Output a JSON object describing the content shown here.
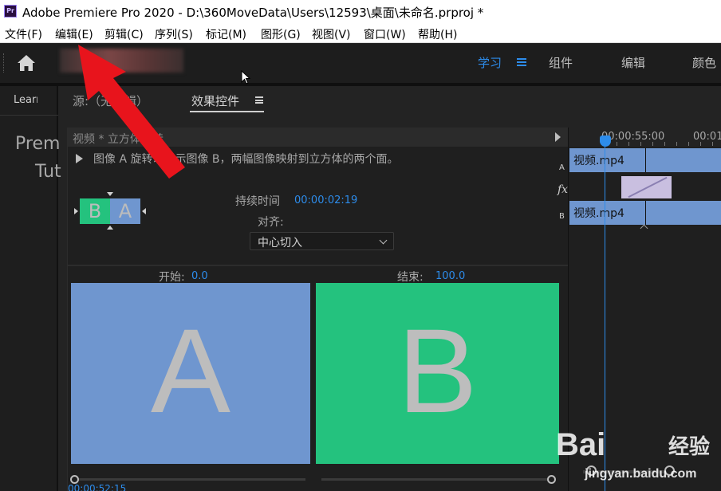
{
  "window": {
    "app_icon_label": "Pr",
    "title": "Adobe Premiere Pro 2020 - D:\\360MoveData\\Users\\12593\\桌面\\未命名.prproj *"
  },
  "menu": [
    "文件(F)",
    "编辑(E)",
    "剪辑(C)",
    "序列(S)",
    "标记(M)",
    "图形(G)",
    "视图(V)",
    "窗口(W)",
    "帮助(H)"
  ],
  "workspace_tabs": [
    "学习",
    "组件",
    "编辑",
    "颜色"
  ],
  "learn_panel": {
    "tab": "Learn",
    "line1": "Prem",
    "line2": "Tut"
  },
  "effect_controls": {
    "tabs": [
      "源:（无剪辑）",
      "效果控件"
    ],
    "breadcrumb": "视频 * 立方体旋转",
    "description": "图像 A 旋转以显示图像 B，两幅图像映射到立方体的两个面。",
    "mini_preview": {
      "left": "B",
      "right": "A"
    },
    "duration_label": "持续时间",
    "duration_value": "00:00:02:19",
    "align_label": "对齐:",
    "align_value": "中心切入",
    "start_label": "开始:",
    "start_value": "0.0",
    "end_label": "结束:",
    "end_value": "100.0",
    "preview_a": "A",
    "preview_b": "B",
    "bottom_time": "00:00:52:15"
  },
  "timeline": {
    "time1": "00:00:55:00",
    "time2": "00:01",
    "track_a": "A",
    "track_b": "B",
    "fx": "fx",
    "clip_a": "视频.mp4",
    "clip_b": "视频.mp4"
  },
  "watermark": {
    "logo": "Bai",
    "cn": "经验",
    "url": "jingyan.baidu.com"
  },
  "colors": {
    "accent_blue": "#2d8ceb",
    "clip_blue": "#6f96cf",
    "clip_green": "#24c27e",
    "transition_purple": "#c9bfe0",
    "annotation_red": "#e8141c"
  }
}
